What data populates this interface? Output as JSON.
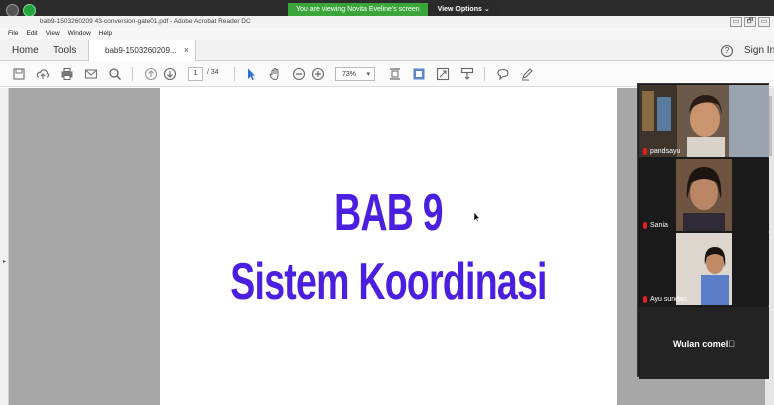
{
  "zoom": {
    "share_message": "You are viewing Novita Eveline's screen",
    "view_options": "View Options ⌄"
  },
  "window": {
    "title": "bab9-1503260209 43-conversion-gate01.pdf - Adobe Acrobat Reader DC",
    "controls": [
      "▭",
      "🗗",
      "▭"
    ]
  },
  "menu": [
    "File",
    "Edit",
    "View",
    "Window",
    "Help"
  ],
  "tabs": {
    "home": "Home",
    "tools": "Tools",
    "document": "bab9-1503260209...",
    "close": "×",
    "help": "?",
    "sign_in": "Sign In"
  },
  "toolbar": {
    "page_current": "1",
    "page_total": "/ 34",
    "zoom": "73%",
    "zoom_caret": "▾"
  },
  "document": {
    "heading_line1": "BAB 9",
    "heading_line2": "Sistem Koordinasi",
    "heading_color": "#4b1fe0"
  },
  "participants": [
    {
      "name": "pandsayu"
    },
    {
      "name": "Sania"
    },
    {
      "name": "Ayu sundari"
    },
    {
      "name": "Wulan comel⃞"
    }
  ]
}
